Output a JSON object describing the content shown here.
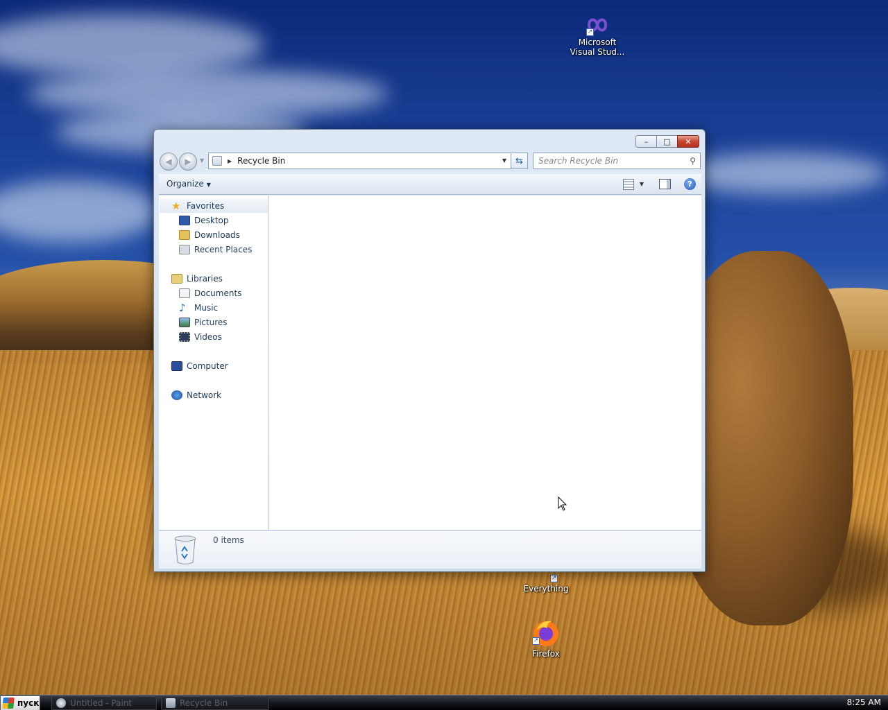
{
  "desktop": {
    "icons": [
      {
        "label_line1": "Microsoft",
        "label_line2": "Visual Stud...",
        "icon": "visual-studio-icon"
      },
      {
        "label": "Everything",
        "icon": "everything-icon"
      },
      {
        "label": "Firefox",
        "icon": "firefox-icon"
      }
    ]
  },
  "window": {
    "controls": {
      "minimize": "–",
      "maximize": "□",
      "close": "✕"
    },
    "address": {
      "path": "Recycle Bin"
    },
    "search": {
      "placeholder": "Search Recycle Bin"
    },
    "toolbar": {
      "organize_label": "Organize"
    },
    "nav": {
      "favorites": "Favorites",
      "favorites_items": [
        "Desktop",
        "Downloads",
        "Recent Places"
      ],
      "libraries": "Libraries",
      "libraries_items": [
        "Documents",
        "Music",
        "Pictures",
        "Videos"
      ],
      "computer": "Computer",
      "network": "Network"
    },
    "details": {
      "items_count": "0 items"
    }
  },
  "taskbar": {
    "start_label": "пуск",
    "tasks": [
      "Untitled - Paint",
      "Recycle Bin"
    ],
    "clock": "8:25 AM"
  },
  "colors": {
    "accent": "#1e395b",
    "close_button": "#c8452d"
  }
}
